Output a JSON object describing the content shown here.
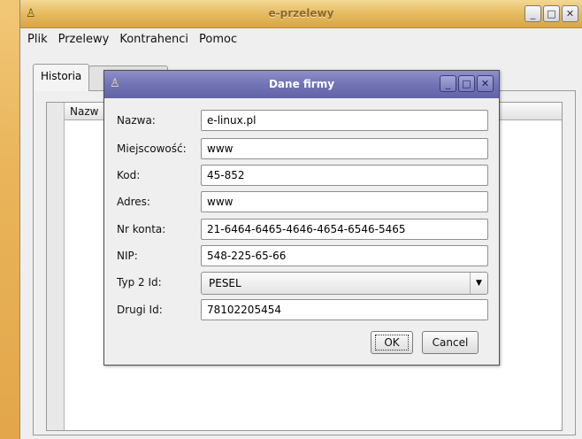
{
  "window": {
    "title": "e-przelewy",
    "menu": [
      "Plik",
      "Przelewy",
      "Kontrahenci",
      "Pomoc"
    ],
    "tabs": [
      "Historia",
      ""
    ],
    "table_column": "Nazw"
  },
  "dialog": {
    "title": "Dane firmy",
    "fields": [
      {
        "label": "Nazwa:",
        "value": "e-linux.pl"
      },
      {
        "label": "Miejscowość:",
        "value": "www"
      },
      {
        "label": "Kod:",
        "value": "45-852"
      },
      {
        "label": "Adres:",
        "value": "www"
      },
      {
        "label": "Nr konta:",
        "value": "21-6464-6465-4646-4654-6546-5465"
      },
      {
        "label": "NIP:",
        "value": "548-225-65-66"
      }
    ],
    "typ_label": "Typ 2 Id:",
    "typ_value": "PESEL",
    "drugi_label": "Drugi Id:",
    "drugi_value": "78102205454",
    "ok_label": "OK",
    "cancel_label": "Cancel"
  },
  "icons": {
    "app": "app-icon",
    "minimize": "minimize-icon",
    "maximize": "maximize-icon",
    "close": "close-icon",
    "dropdown": "chevron-down-icon"
  },
  "colors": {
    "desktop": "#e8b457",
    "main_titlebar": "#e5b85c",
    "dialog_titlebar": "#7272b6"
  }
}
